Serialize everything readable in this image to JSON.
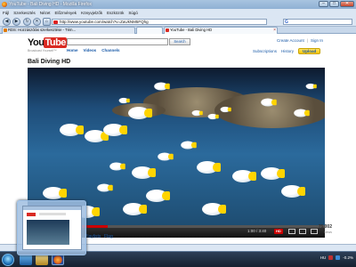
{
  "window": {
    "title": "YouTube - Bali Diving HD - Mozilla Firefox",
    "min_label": "–",
    "max_label": "□",
    "close_label": "✕"
  },
  "menu": [
    "Fájl",
    "Szerkesztés",
    "Nézet",
    "Előzmények",
    "Könyvjelzők",
    "Eszközök",
    "Súgó"
  ],
  "nav": {
    "back_label": "◀",
    "forward_label": "▶",
    "url": "http://www.youtube.com/watch?v=ZaUkNM5FQhg"
  },
  "tabs": [
    {
      "label": "RDS: Hozzászólás szerkesztése - Tém...",
      "active": false,
      "icon_color": "#e07a00"
    },
    {
      "label": "YouTube - Bali Diving HD",
      "active": true,
      "icon_color": "#d92a22"
    }
  ],
  "youtube": {
    "logo_you": "You",
    "logo_tube": "Tube",
    "logo_sub": "Broadcast Yourself™",
    "search_button": "Search",
    "nav": [
      "Home",
      "Videos",
      "Channels"
    ],
    "top_links": [
      "Create Account",
      "Sign In"
    ],
    "sub_links": [
      "Subscriptions",
      "History"
    ],
    "upload_label": "Upload",
    "video_title": "Bali Diving HD",
    "time": "1:00 / 3:40",
    "hd_label": "HD",
    "progress_fraction": 0.27,
    "views": "75,002",
    "views_label": "views",
    "playlists_label": "Playlists",
    "flag_label": "Flag"
  },
  "taskbar": {
    "tray_lang": "HU",
    "tray_zoom": "-0.2%"
  }
}
